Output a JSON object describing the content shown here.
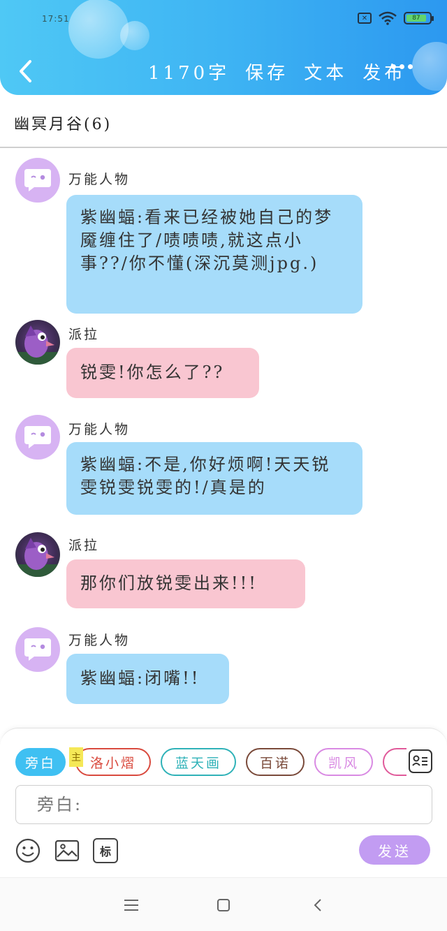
{
  "status_bar": {
    "time": "17:51",
    "sim_icon": "sim-off-icon",
    "wifi_icon": "wifi-icon",
    "battery_level": "87"
  },
  "header": {
    "back_icon": "chevron-left-icon",
    "word_count": "1170字",
    "save_label": "保存",
    "text_label": "文本",
    "publish_label": "发布",
    "more_icon": "more-icon",
    "gradient_start": "#4fc8f5",
    "gradient_end": "#2c98f0"
  },
  "chat": {
    "title": "幽冥月谷(6)"
  },
  "messages": [
    {
      "sender": "万能人物",
      "text": "紫幽蝠:看来已经被她自己的梦魇缠住了/啧啧啧,就这点小事??/你不懂(深沉莫测jpg.)",
      "color": "#a6dcfa"
    },
    {
      "sender": "派拉",
      "text": "锐雯!你怎么了??",
      "color": "#f9c6d1"
    },
    {
      "sender": "万能人物",
      "text": "紫幽蝠:不是,你好烦啊!天天锐雯锐雯锐雯的!/真是的",
      "color": "#a6dcfa"
    },
    {
      "sender": "派拉",
      "text": "那你们放锐雯出来!!!",
      "color": "#f9c6d1"
    },
    {
      "sender": "万能人物",
      "text": "紫幽蝠:闭嘴!!",
      "color": "#a6dcfa"
    }
  ],
  "roles": [
    {
      "label": "旁白",
      "active": true
    },
    {
      "label": "洛小熠",
      "color": "#d94a3e"
    },
    {
      "label": "蓝天画",
      "color": "#2fb2b8"
    },
    {
      "label": "百诺",
      "color": "#7a4a3a"
    },
    {
      "label": "凯风",
      "color": "#d98ae3"
    },
    {
      "label": "",
      "color": "#e05a9a"
    }
  ],
  "main_tag": "主",
  "input": {
    "placeholder": "旁白:"
  },
  "toolbar": {
    "emoji_icon": "smiley-icon",
    "image_icon": "image-icon",
    "tag_label": "标",
    "send_label": "发送"
  },
  "navbar": {
    "menu_icon": "menu-icon",
    "home_icon": "square-home-icon",
    "back_icon": "back-triangle-icon"
  }
}
